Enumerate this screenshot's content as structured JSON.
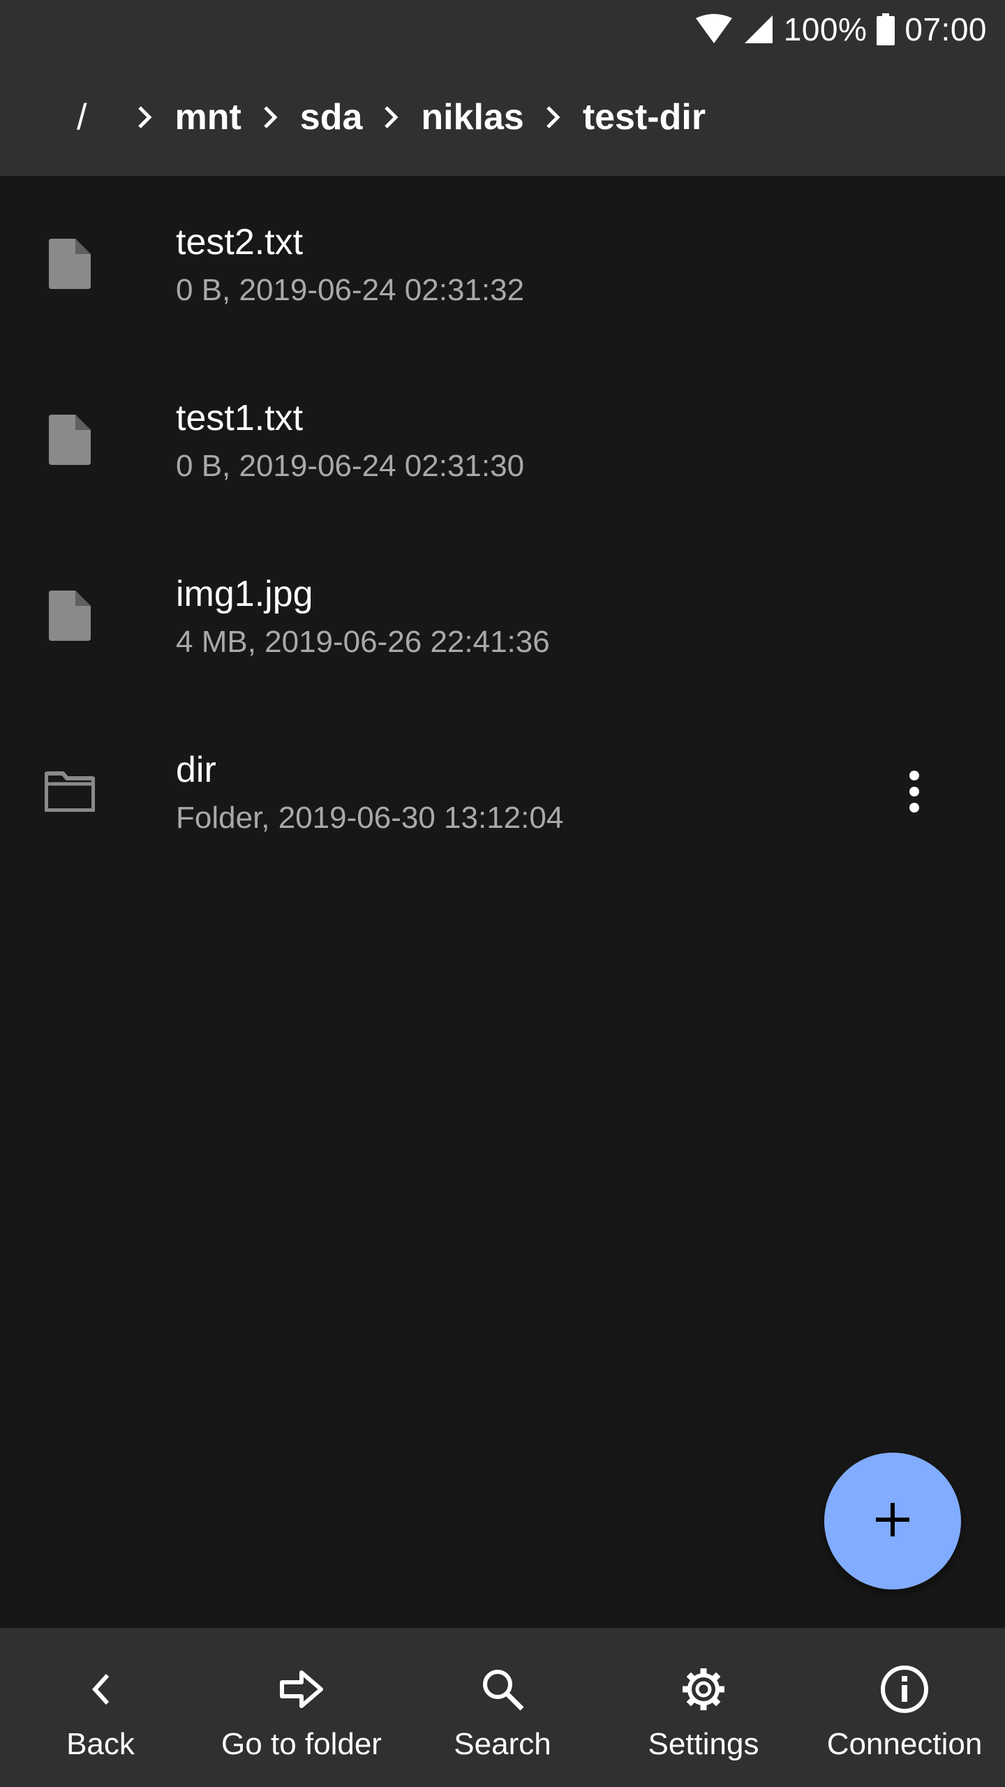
{
  "status_bar": {
    "battery": "100%",
    "time": "07:00"
  },
  "breadcrumb": {
    "root": "/",
    "segments": [
      "mnt",
      "sda",
      "niklas",
      "test-dir"
    ]
  },
  "files": [
    {
      "name": "test2.txt",
      "meta": "0 B, 2019-06-24 02:31:32",
      "icon": "file-icon"
    },
    {
      "name": "test1.txt",
      "meta": "0 B, 2019-06-24 02:31:30",
      "icon": "file-icon"
    },
    {
      "name": "img1.jpg",
      "meta": "4 MB, 2019-06-26 22:41:36",
      "icon": "file-icon"
    },
    {
      "name": "dir",
      "meta": "Folder, 2019-06-30 13:12:04",
      "icon": "folder-icon"
    }
  ],
  "fab": {
    "icon": "plus-icon"
  },
  "bottom_nav": [
    {
      "label": "Back",
      "icon": "chevron-left-icon"
    },
    {
      "label": "Go to folder",
      "icon": "arrow-right-icon"
    },
    {
      "label": "Search",
      "icon": "search-icon"
    },
    {
      "label": "Settings",
      "icon": "gear-icon"
    },
    {
      "label": "Connection",
      "icon": "info-icon"
    }
  ],
  "colors": {
    "background": "#171717",
    "bars": "#303030",
    "accent": "#82acff",
    "secondary_text": "#a9a9a9",
    "icon_gray": "#8a8a8a"
  }
}
